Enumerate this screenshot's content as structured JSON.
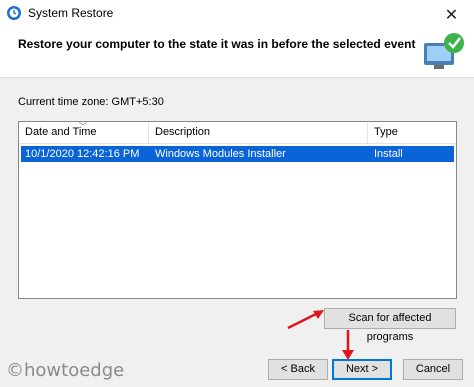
{
  "window": {
    "title": "System Restore",
    "close": "✕"
  },
  "header": {
    "text": "Restore your computer to the state it was in before the selected event"
  },
  "timezone": "Current time zone: GMT+5:30",
  "table": {
    "columns": [
      "Date and Time",
      "Description",
      "Type"
    ],
    "rows": [
      {
        "date": "10/1/2020 12:42:16 PM",
        "description": "Windows Modules Installer",
        "type": "Install",
        "selected": true
      }
    ]
  },
  "buttons": {
    "scan": "Scan for affected programs",
    "back": "< Back",
    "next": "Next >",
    "cancel": "Cancel"
  },
  "watermark": "©howtoedge",
  "colors": {
    "selection": "#0a64d8",
    "annotation_arrow": "#e0141e"
  }
}
